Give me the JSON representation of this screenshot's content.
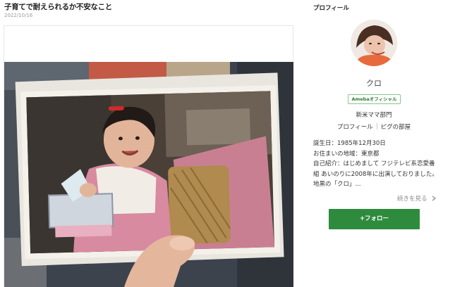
{
  "article": {
    "title": "子育てで耐えられるか不安なこと",
    "date": "2022/10/16"
  },
  "sidebar": {
    "heading": "プロフィール",
    "name": "クロ",
    "badge": "Amebaオフィシャル",
    "group": "新米ママ部門",
    "links": [
      "プロフィール",
      "ピグの部屋"
    ],
    "bio": [
      "誕生日：1985年12月30日",
      "お住まいの地域：東京都",
      "自己紹介：はじめまして フジテレビ系恋愛番",
      "組 あいのりに2008年に出演しておりました。",
      "地黒の「クロ」..."
    ],
    "read_more": "続きを見る",
    "follow_label": "+フォロー"
  },
  "colors": {
    "follow_button": "#2e8b3e",
    "badge_border": "#8bc48f"
  },
  "icons": {
    "read_more": "chevron-right-icon"
  }
}
